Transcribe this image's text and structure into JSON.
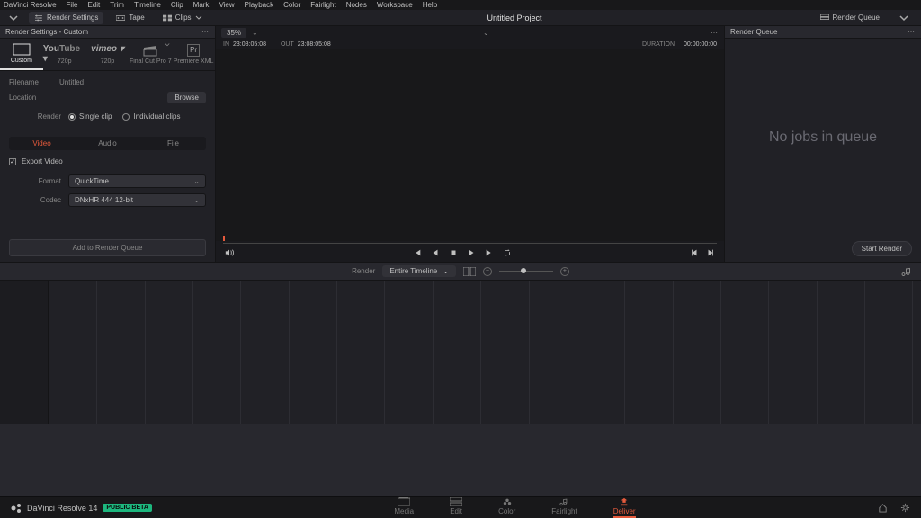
{
  "menu": [
    "DaVinci Resolve",
    "File",
    "Edit",
    "Trim",
    "Timeline",
    "Clip",
    "Mark",
    "View",
    "Playback",
    "Color",
    "Fairlight",
    "Nodes",
    "Workspace",
    "Help"
  ],
  "toolbar": {
    "render_settings": "Render Settings",
    "tape": "Tape",
    "clips": "Clips",
    "project_title": "Untitled Project",
    "render_queue": "Render Queue"
  },
  "left": {
    "title": "Render Settings - Custom",
    "presets": [
      {
        "label": "Custom"
      },
      {
        "label": "720p"
      },
      {
        "label": "720p"
      },
      {
        "label": "Final Cut Pro 7"
      },
      {
        "label": "Premiere XML"
      }
    ],
    "filename_label": "Filename",
    "filename_value": "Untitled",
    "location_label": "Location",
    "browse": "Browse",
    "render_label": "Render",
    "single_clip": "Single clip",
    "individual_clips": "Individual clips",
    "tabs": [
      "Video",
      "Audio",
      "File"
    ],
    "export_video": "Export Video",
    "format_label": "Format",
    "format_value": "QuickTime",
    "codec_label": "Codec",
    "codec_value": "DNxHR 444 12-bit",
    "add_queue": "Add to Render Queue"
  },
  "viewer": {
    "zoom": "35%",
    "in_label": "IN",
    "in_tc": "23:08:05:08",
    "out_label": "OUT",
    "out_tc": "23:08:05:08",
    "dur_label": "DURATION",
    "dur_tc": "00:00:00:00"
  },
  "right": {
    "title": "Render Queue",
    "empty": "No jobs in queue",
    "start": "Start Render"
  },
  "midrow": {
    "render_label": "Render",
    "scope": "Entire Timeline"
  },
  "pages": {
    "brand": "DaVinci Resolve 14",
    "beta": "PUBLIC BETA",
    "tabs": [
      "Media",
      "Edit",
      "Color",
      "Fairlight",
      "Deliver"
    ]
  }
}
